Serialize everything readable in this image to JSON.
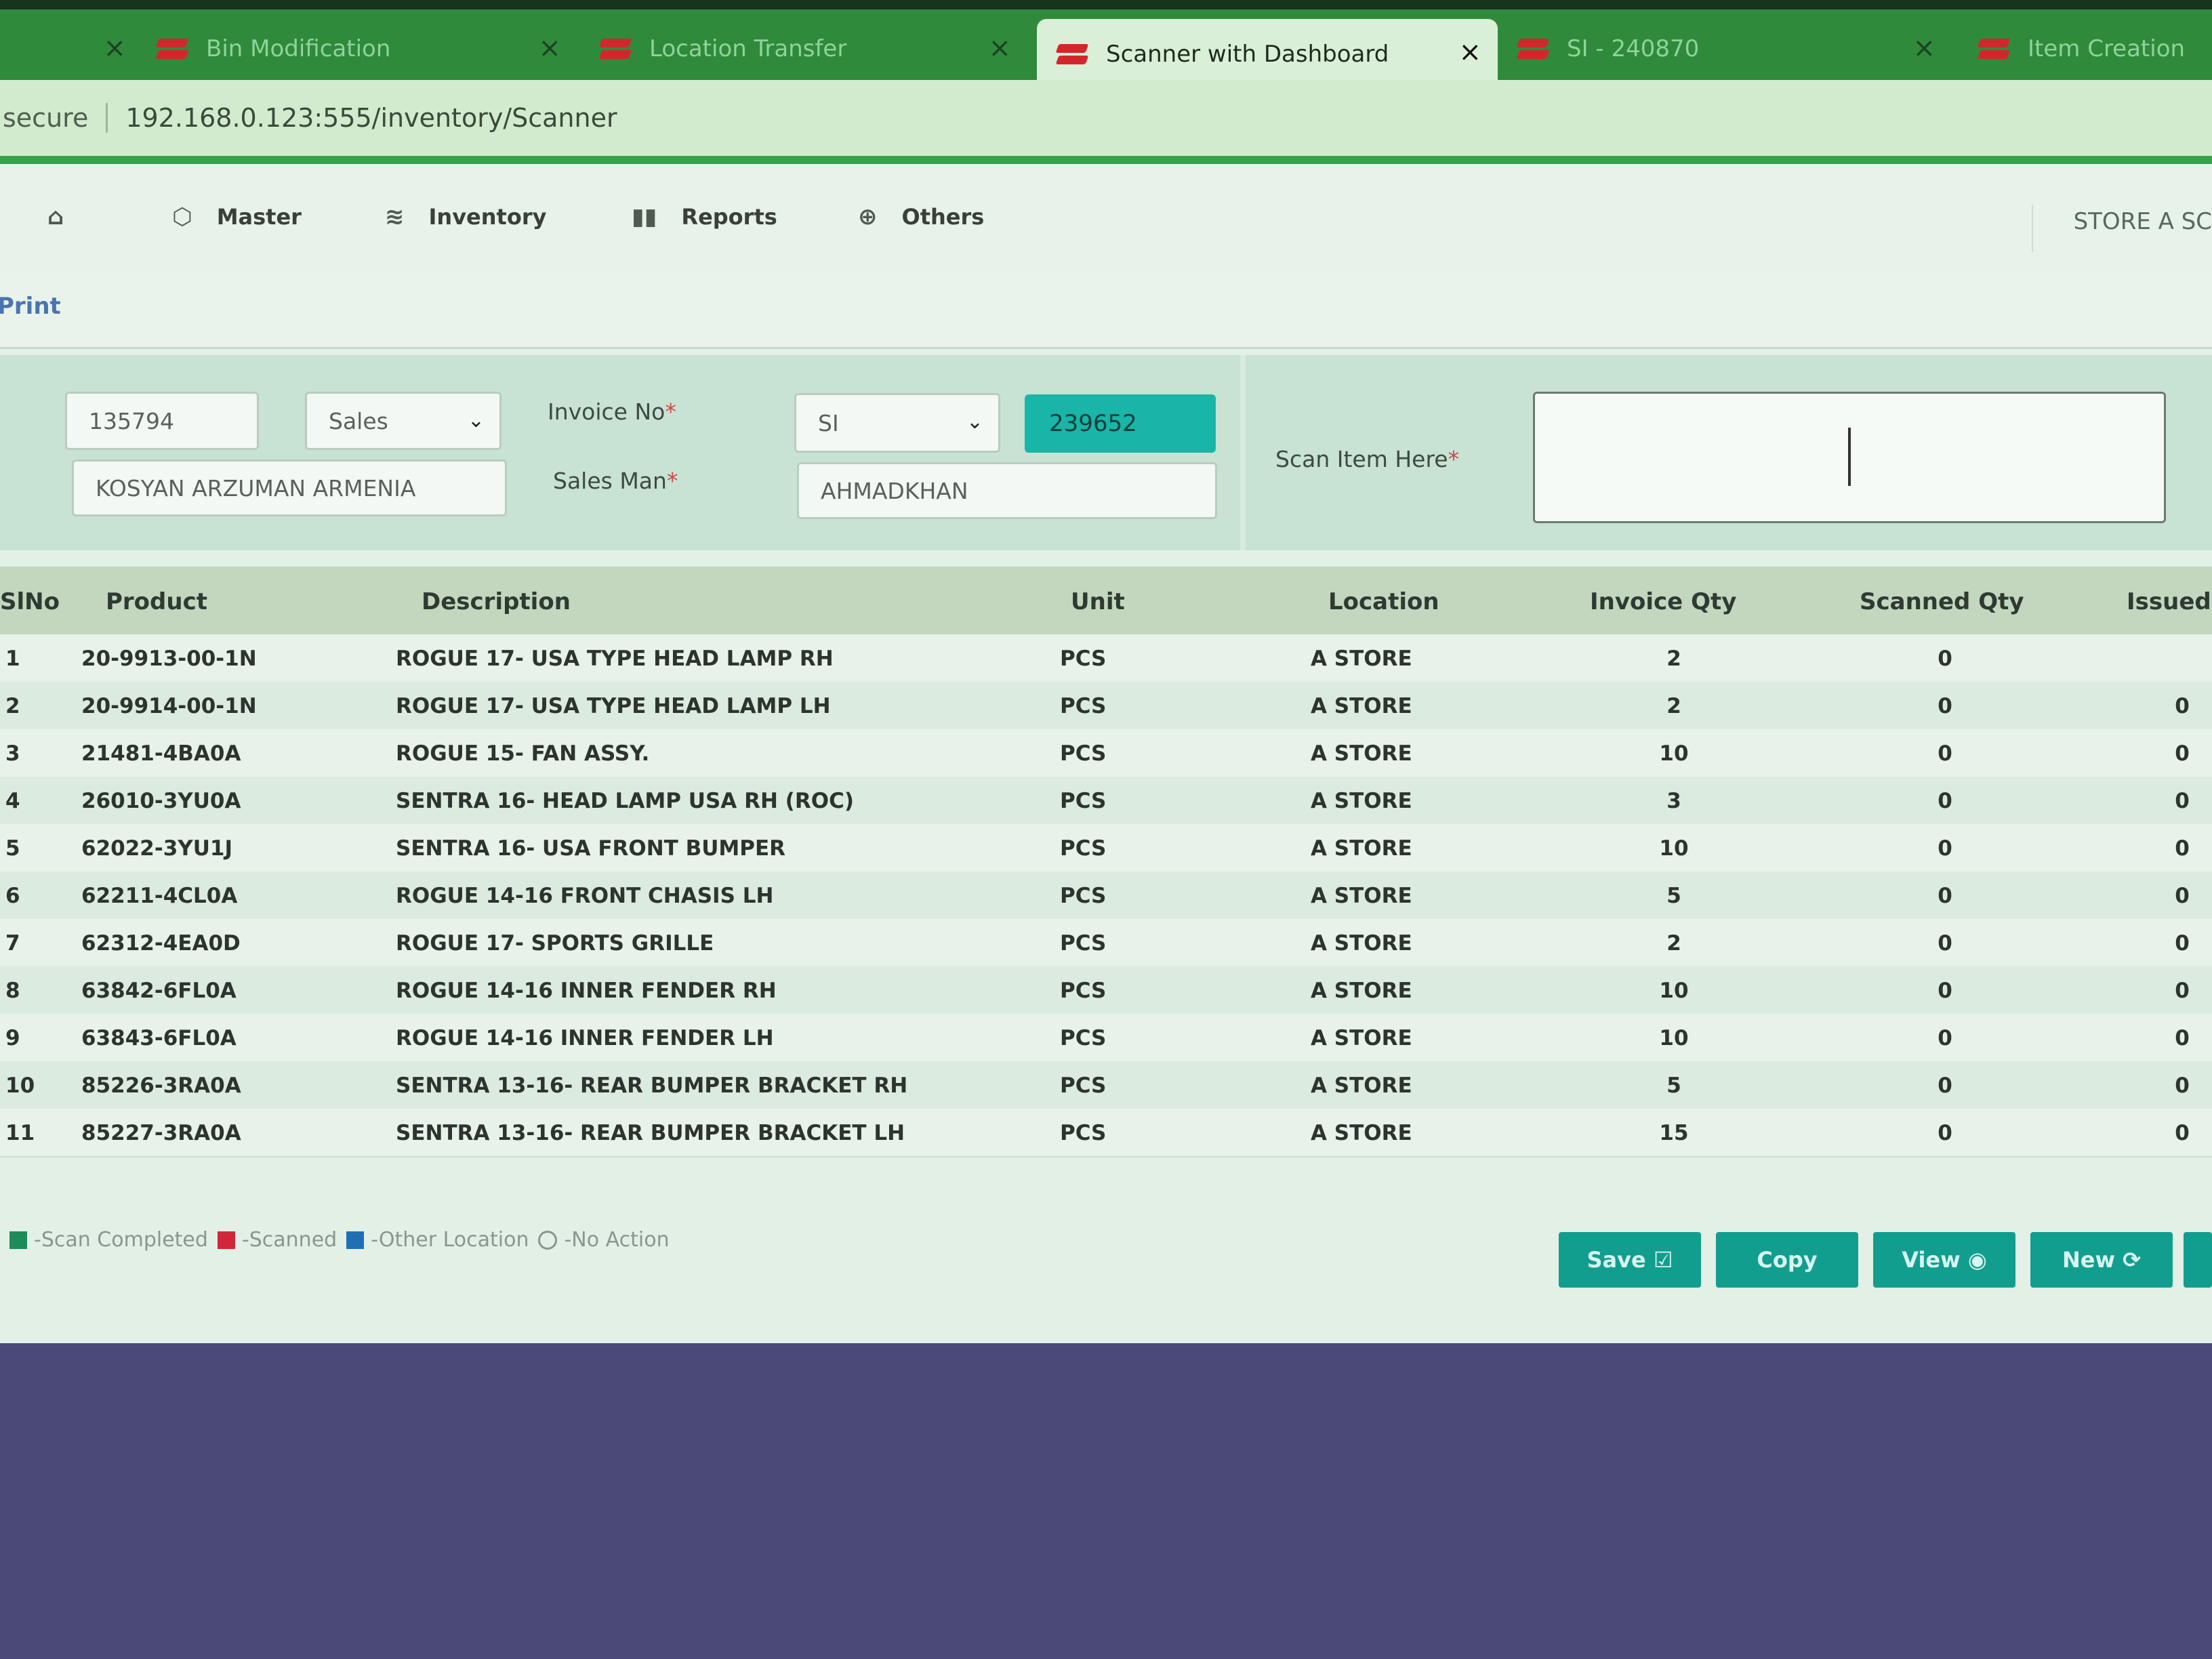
{
  "browser": {
    "tabs": [
      {
        "label": "",
        "active": false
      },
      {
        "label": "Bin Modification",
        "active": false
      },
      {
        "label": "Location Transfer",
        "active": false
      },
      {
        "label": "Scanner with Dashboard",
        "active": true
      },
      {
        "label": "SI - 240870",
        "active": false
      },
      {
        "label": "Item Creation",
        "active": false
      }
    ],
    "close_glyph": "×",
    "security": "secure",
    "url": "192.168.0.123:555/inventory/Scanner"
  },
  "nav": {
    "items": [
      {
        "icon": "home-icon",
        "label": ""
      },
      {
        "icon": "cube-icon",
        "label": "Master"
      },
      {
        "icon": "stack-icon",
        "label": "Inventory"
      },
      {
        "icon": "bar-chart-icon",
        "label": "Reports"
      },
      {
        "icon": "globe-icon",
        "label": "Others"
      }
    ],
    "store": "STORE A SC"
  },
  "subbar": {
    "print": "Print"
  },
  "form": {
    "customer_code": "135794",
    "type_select": "Sales",
    "customer_name": "KOSYAN ARZUMAN ARMENIA",
    "invoice_label": "Invoice No",
    "invoice_prefix": "SI",
    "invoice_number": "239652",
    "salesman_label": "Sales Man",
    "salesman": "AHMADKHAN",
    "scan_label": "Scan Item Here",
    "required_mark": "*"
  },
  "table": {
    "columns": [
      "SlNo",
      "Product",
      "Description",
      "Unit",
      "Location",
      "Invoice Qty",
      "Scanned Qty",
      "Issued"
    ],
    "rows": [
      {
        "sl": "1",
        "product": "20-9913-00-1N",
        "desc": "ROGUE 17- USA TYPE HEAD LAMP RH",
        "unit": "PCS",
        "loc": "A STORE",
        "inv": "2",
        "scan": "0",
        "issued": ""
      },
      {
        "sl": "2",
        "product": "20-9914-00-1N",
        "desc": "ROGUE 17- USA TYPE HEAD LAMP LH",
        "unit": "PCS",
        "loc": "A STORE",
        "inv": "2",
        "scan": "0",
        "issued": "0"
      },
      {
        "sl": "3",
        "product": "21481-4BA0A",
        "desc": "ROGUE 15- FAN ASSY.",
        "unit": "PCS",
        "loc": "A STORE",
        "inv": "10",
        "scan": "0",
        "issued": "0"
      },
      {
        "sl": "4",
        "product": "26010-3YU0A",
        "desc": "SENTRA 16- HEAD LAMP USA RH (ROC)",
        "unit": "PCS",
        "loc": "A STORE",
        "inv": "3",
        "scan": "0",
        "issued": "0"
      },
      {
        "sl": "5",
        "product": "62022-3YU1J",
        "desc": "SENTRA 16- USA FRONT BUMPER",
        "unit": "PCS",
        "loc": "A STORE",
        "inv": "10",
        "scan": "0",
        "issued": "0"
      },
      {
        "sl": "6",
        "product": "62211-4CL0A",
        "desc": "ROGUE 14-16 FRONT CHASIS LH",
        "unit": "PCS",
        "loc": "A STORE",
        "inv": "5",
        "scan": "0",
        "issued": "0"
      },
      {
        "sl": "7",
        "product": "62312-4EA0D",
        "desc": "ROGUE 17- SPORTS GRILLE",
        "unit": "PCS",
        "loc": "A STORE",
        "inv": "2",
        "scan": "0",
        "issued": "0"
      },
      {
        "sl": "8",
        "product": "63842-6FL0A",
        "desc": "ROGUE 14-16 INNER FENDER RH",
        "unit": "PCS",
        "loc": "A STORE",
        "inv": "10",
        "scan": "0",
        "issued": "0"
      },
      {
        "sl": "9",
        "product": "63843-6FL0A",
        "desc": "ROGUE 14-16 INNER FENDER LH",
        "unit": "PCS",
        "loc": "A STORE",
        "inv": "10",
        "scan": "0",
        "issued": "0"
      },
      {
        "sl": "10",
        "product": "85226-3RA0A",
        "desc": "SENTRA 13-16- REAR BUMPER BRACKET RH",
        "unit": "PCS",
        "loc": "A STORE",
        "inv": "5",
        "scan": "0",
        "issued": "0"
      },
      {
        "sl": "11",
        "product": "85227-3RA0A",
        "desc": "SENTRA 13-16- REAR BUMPER BRACKET LH",
        "unit": "PCS",
        "loc": "A STORE",
        "inv": "15",
        "scan": "0",
        "issued": "0"
      }
    ]
  },
  "legend": [
    {
      "color": "#1f8a5a",
      "label": "-Scan Completed"
    },
    {
      "color": "#d0283a",
      "label": "-Scanned"
    },
    {
      "color": "#1f6fb5",
      "label": "-Other Location"
    },
    {
      "color": "none",
      "label": "-No Action"
    }
  ],
  "buttons": {
    "save": "Save ☑",
    "copy": "Copy",
    "view": "View ◉",
    "new": "New ⟳"
  },
  "colors": {
    "accent": "#129e8f",
    "tab_bar": "#2f8a3c",
    "invoice_badge": "#19b5a8"
  }
}
